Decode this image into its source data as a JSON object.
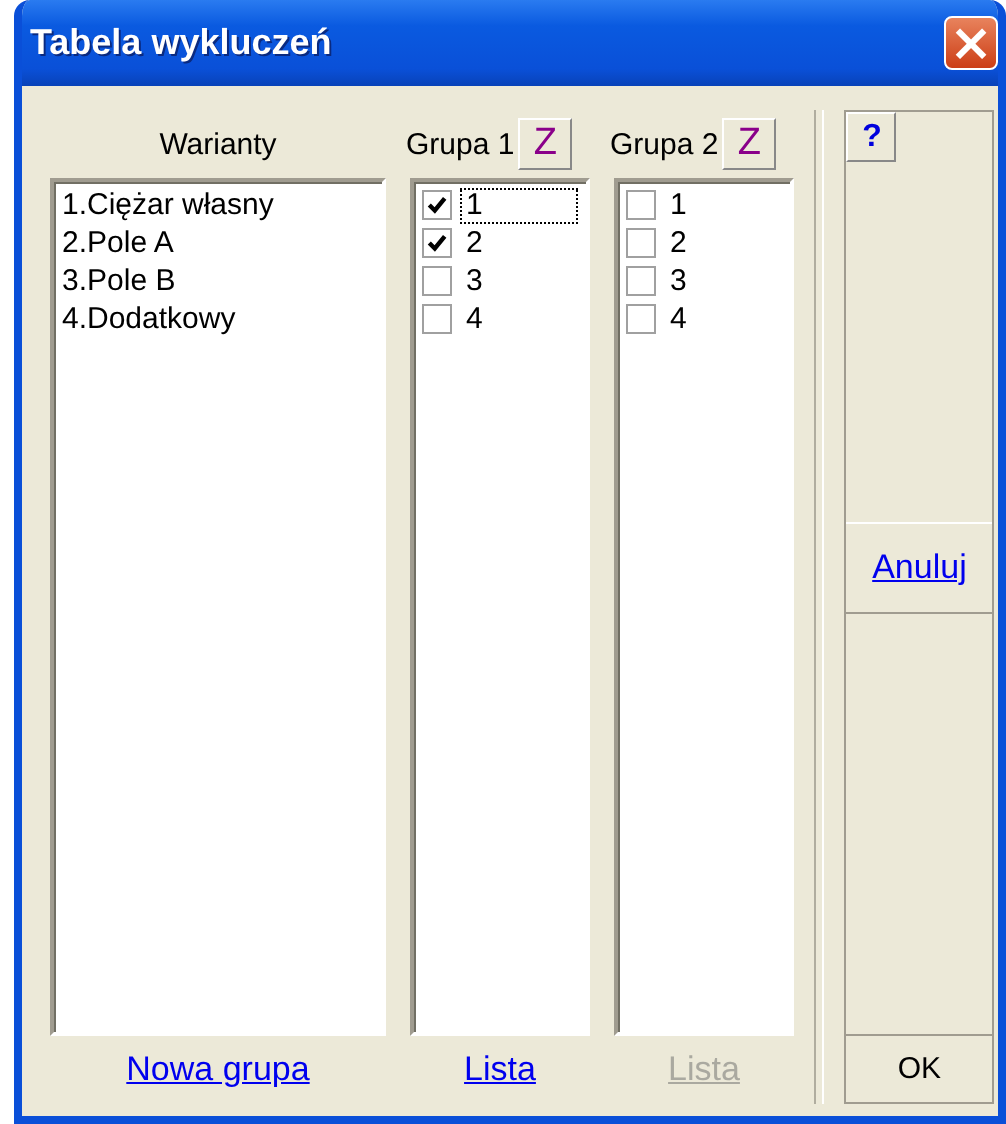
{
  "window": {
    "title": "Tabela wykluczeń",
    "close": "×"
  },
  "variants": {
    "header": "Warianty",
    "items": [
      "1.Ciężar własny",
      "2.Pole A",
      "3.Pole B",
      "4.Dodatkowy"
    ],
    "link": {
      "label": "Nowa grupa",
      "disabled": false
    }
  },
  "groups": [
    {
      "title": "Grupa 1",
      "button": "Z",
      "items": [
        {
          "label": "1",
          "checked": true,
          "focused": true
        },
        {
          "label": "2",
          "checked": true,
          "focused": false
        },
        {
          "label": "3",
          "checked": false,
          "focused": false
        },
        {
          "label": "4",
          "checked": false,
          "focused": false
        }
      ],
      "link": {
        "label": "Lista",
        "disabled": false
      }
    },
    {
      "title": "Grupa 2",
      "button": "Z",
      "items": [
        {
          "label": "1",
          "checked": false,
          "focused": false
        },
        {
          "label": "2",
          "checked": false,
          "focused": false
        },
        {
          "label": "3",
          "checked": false,
          "focused": false
        },
        {
          "label": "4",
          "checked": false,
          "focused": false
        }
      ],
      "link": {
        "label": "Lista",
        "disabled": true
      }
    }
  ],
  "side": {
    "help": "?",
    "cancel": "Anuluj",
    "ok": "OK"
  }
}
